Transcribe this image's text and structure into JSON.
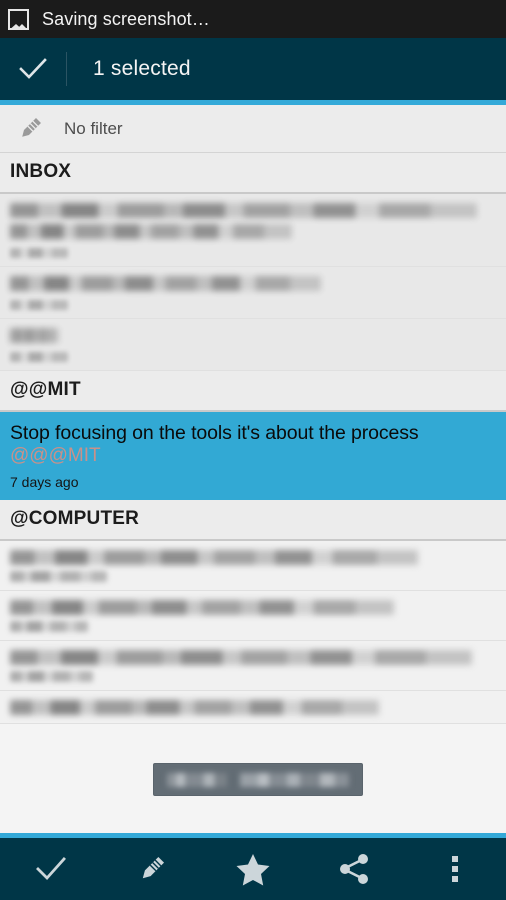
{
  "statusbar": {
    "icon": "photo-icon",
    "text": "Saving screenshot…"
  },
  "actionbar": {
    "back_icon": "check-icon",
    "selected_label": "1 selected",
    "bg_color": "#003647",
    "accent_color": "#33a9d8"
  },
  "filterbar": {
    "icon": "pencil-icon",
    "label": "No filter"
  },
  "sections": [
    {
      "header": "INBOX",
      "rows": [
        {
          "redacted": true,
          "lines": 2,
          "has_subtitle": false,
          "has_timestamp": true
        },
        {
          "redacted": true,
          "lines": 1,
          "has_subtitle": false,
          "has_timestamp": true
        },
        {
          "redacted": true,
          "lines": 1,
          "has_subtitle": false,
          "has_timestamp": true
        }
      ]
    },
    {
      "header": "@@MIT",
      "rows": [
        {
          "redacted": false,
          "selected": true,
          "title": "Stop focusing on the tools it's about the process",
          "tag": "@@@MIT",
          "timestamp": "7 days ago",
          "bg_color": "#32a9d4",
          "tag_color": "#c9918a"
        }
      ]
    },
    {
      "header": "@COMPUTER",
      "rows": [
        {
          "redacted": true,
          "lines": 1,
          "has_subtitle": true,
          "has_timestamp": true
        },
        {
          "redacted": true,
          "lines": 1,
          "has_subtitle": true,
          "has_timestamp": true
        },
        {
          "redacted": true,
          "lines": 1,
          "has_subtitle": true,
          "has_timestamp": true
        },
        {
          "redacted": true,
          "lines": 1,
          "has_subtitle": false,
          "has_timestamp": false
        }
      ]
    }
  ],
  "toast": {
    "redacted": true,
    "bg_color": "#636d75"
  },
  "toolbar": {
    "bg_color": "#003647",
    "accent_color": "#33a9d8",
    "buttons": [
      {
        "icon": "check-icon",
        "name": "complete-button"
      },
      {
        "icon": "pencil-icon",
        "name": "edit-button"
      },
      {
        "icon": "star-icon",
        "name": "star-button"
      },
      {
        "icon": "share-icon",
        "name": "share-button"
      },
      {
        "icon": "overflow-icon",
        "name": "overflow-button"
      }
    ]
  }
}
